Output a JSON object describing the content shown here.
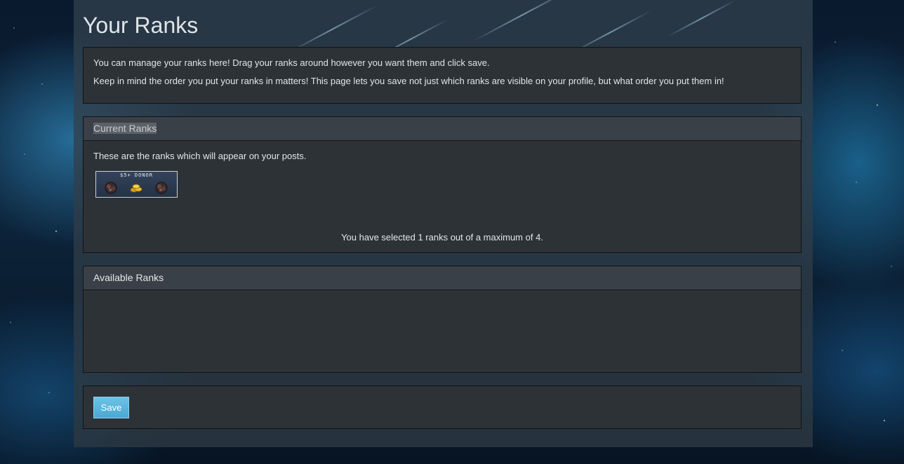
{
  "page_title": "Your Ranks",
  "intro": {
    "line1": "You can manage your ranks here! Drag your ranks around however you want them and click save.",
    "line2": "Keep in mind the order you put your ranks in matters! This page lets you save not just which ranks are visible on your profile, but what order you put them in!"
  },
  "current_ranks": {
    "heading": "Current Ranks",
    "description": "These are the ranks which will appear on your posts.",
    "ranks": [
      {
        "label": "$5+ DONOR",
        "icons": [
          "dark-gem-icon",
          "gold-coins-icon",
          "dark-gem-icon"
        ]
      }
    ],
    "count_text": "You have selected 1 ranks out of a maximum of 4."
  },
  "available_ranks": {
    "heading": "Available Ranks"
  },
  "actions": {
    "save_label": "Save"
  },
  "colors": {
    "accent": "#5bb7df",
    "panel": "#2d3237",
    "panel_header": "#3a4048"
  }
}
